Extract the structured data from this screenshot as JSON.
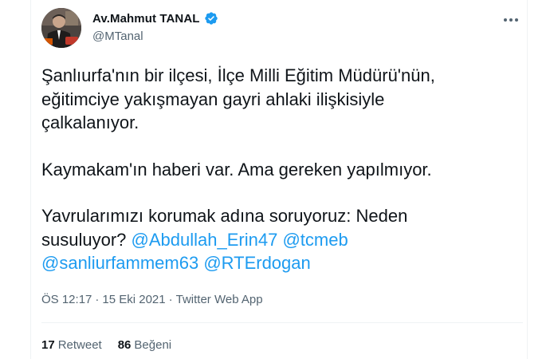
{
  "author": {
    "display_name": "Av.Mahmut TANAL",
    "handle": "@MTanal",
    "verified": true
  },
  "tweet": {
    "line1": "Şanlıurfa'nın bir ilçesi, İlçe Milli Eğitim Müdürü'nün,",
    "line2": "eğitimciye yakışmayan gayri ahlaki ilişkisiyle",
    "line3": "çalkalanıyor.",
    "para2": "Kaymakam'ın haberi var. Ama gereken yapılmıyor.",
    "para3_line1": "Yavrularımızı korumak adına soruyoruz: Neden",
    "para3_line2_prefix": "susuluyor?",
    "mentions": [
      "@Abdullah_Erin47",
      "@tcmeb",
      "@sanliurfammem63",
      "@RTErdogan"
    ]
  },
  "meta": {
    "time": "ÖS 12:17",
    "separator": "·",
    "date": "15 Eki 2021",
    "app": "Twitter Web App"
  },
  "stats": {
    "retweets_count": "17",
    "retweets_label": "Retweet",
    "likes_count": "86",
    "likes_label": "Beğeni"
  },
  "colors": {
    "link": "#1d9bf0",
    "secondary_text": "#536471",
    "primary_text": "#0f1419",
    "divider": "#eff3f4"
  },
  "icons": {
    "verified": "verified-badge-icon",
    "more": "more-options-icon"
  }
}
